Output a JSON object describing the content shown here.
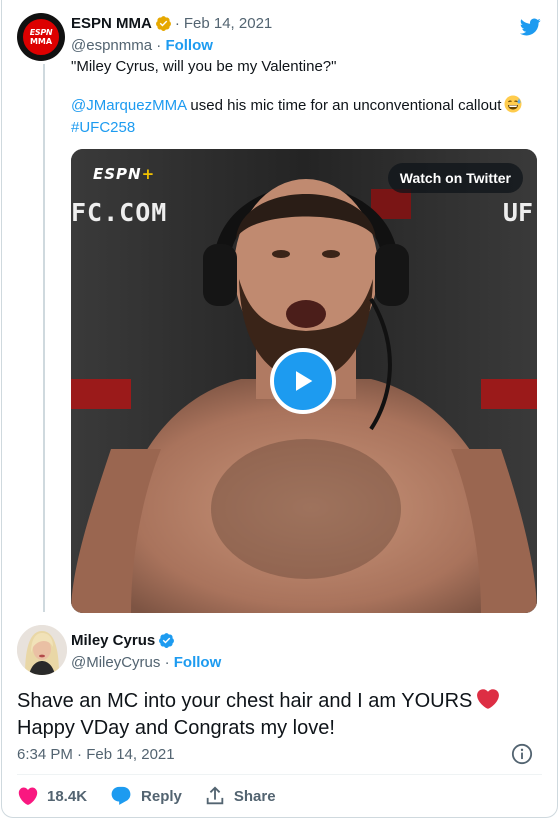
{
  "quoted_tweet": {
    "author_name": "ESPN MMA",
    "avatar_text_top": "ESPN",
    "avatar_text_bottom": "MMA",
    "date": "Feb 14, 2021",
    "handle": "@espnmma",
    "follow_label": "Follow",
    "text_line1": "\"Miley Cyrus, will you be my Valentine?\"",
    "mention": "@JMarquezMMA",
    "text_line2_rest": " used his mic time for an unconventional callout",
    "hashtag": "#UFC258",
    "video": {
      "brand": "ESPN",
      "brand_plus": "+",
      "backdrop_left": "FC.COM",
      "backdrop_right": "UF",
      "watch_label": "Watch on Twitter"
    }
  },
  "reply_tweet": {
    "author_name": "Miley Cyrus",
    "handle": "@MileyCyrus",
    "follow_label": "Follow",
    "text_line1": "Shave an MC into your chest hair and I am YOURS",
    "text_line2": "Happy VDay and Congrats my love!",
    "timestamp": "6:34 PM · Feb 14, 2021"
  },
  "actions": {
    "like_count": "18.4K",
    "reply_label": "Reply",
    "share_label": "Share"
  },
  "colors": {
    "accent": "#1d9bf0",
    "like": "#f91880",
    "verified": "#1d9bf0",
    "muted": "#536471"
  },
  "icons": [
    "twitter-bird-icon",
    "verified-badge-icon",
    "play-icon",
    "info-icon",
    "heart-icon",
    "reply-bubble-icon",
    "share-icon"
  ]
}
